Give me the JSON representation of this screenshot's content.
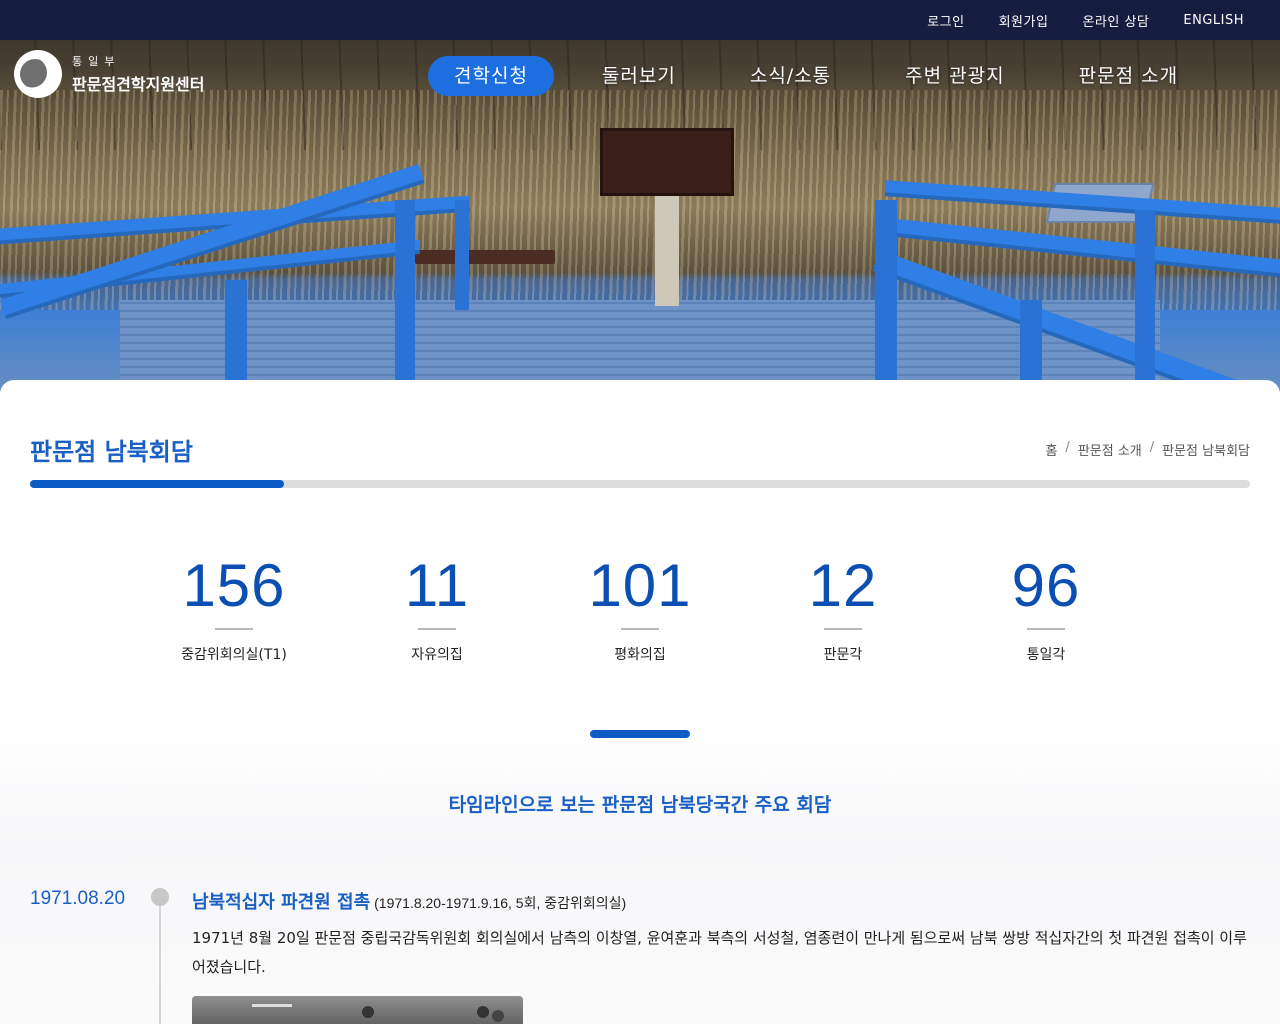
{
  "utility_menu": {
    "login": "로그인",
    "signup": "회원가입",
    "consult": "온라인 상담",
    "english": "ENGLISH"
  },
  "logo": {
    "ministry": "통일부",
    "center": "판문점견학지원센터"
  },
  "nav": {
    "items": [
      "견학신청",
      "둘러보기",
      "소식/소통",
      "주변 관광지",
      "판문점 소개"
    ],
    "active_index": 0
  },
  "page": {
    "title": "판문점 남북회담",
    "breadcrumb": [
      "홈",
      "판문점 소개",
      "판문점 남북회담"
    ],
    "breadcrumb_sep": "/",
    "progress": 0.208
  },
  "stats": [
    {
      "value": "156",
      "label": "중감위회의실(T1)"
    },
    {
      "value": "11",
      "label": "자유의집"
    },
    {
      "value": "101",
      "label": "평화의집"
    },
    {
      "value": "12",
      "label": "판문각"
    },
    {
      "value": "96",
      "label": "통일각"
    }
  ],
  "timeline": {
    "title": "타임라인으로 보는 판문점 남북당국간 주요 회담",
    "entries": [
      {
        "date": "1971.08.20",
        "heading": "남북적십자 파견원 접촉",
        "sub": "(1971.8.20-1971.9.16, 5회, 중감위회의실)",
        "body": "1971년 8월 20일 판문점 중립국감독위원회 회의실에서 남측의 이창열, 윤여훈과 북측의 서성철, 염종련이 만나게 됨으로써 남북 쌍방 적십자간의 첫 파견원 접촉이 이루어졌습니다."
      }
    ]
  },
  "colors": {
    "primary": "#1a5fc4",
    "stat_number": "#0b4fb3",
    "nav_active": "#1d6fe0",
    "topbar": "#121c42"
  }
}
